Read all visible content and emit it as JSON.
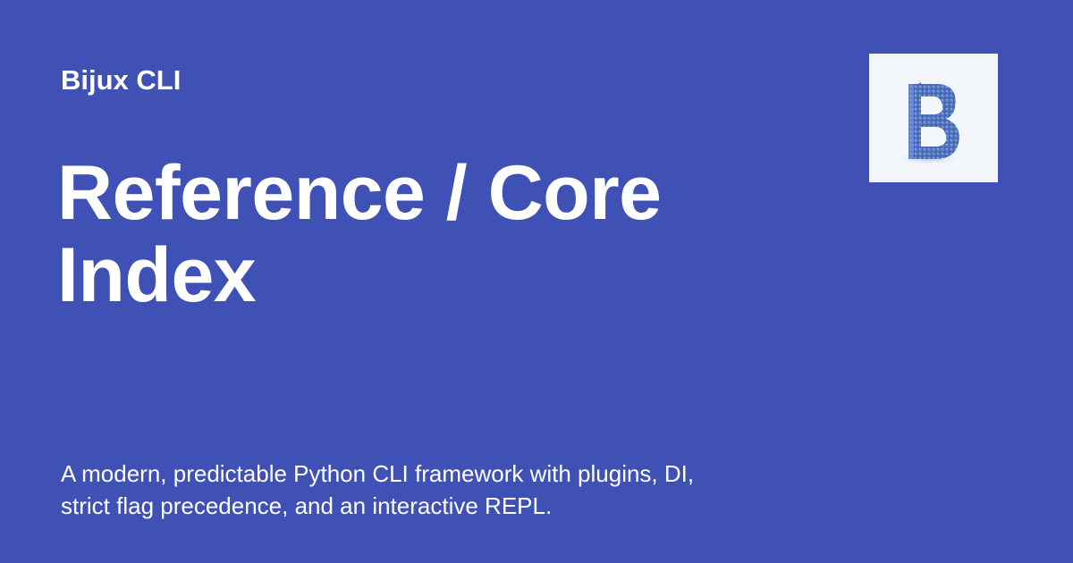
{
  "header": {
    "site_name": "Bijux CLI"
  },
  "page": {
    "title_line1": "Reference / Core",
    "title_line2": "Index",
    "description_line1": "A modern, predictable Python CLI framework with plugins, DI,",
    "description_line2": "strict flag precedence, and an interactive REPL."
  },
  "logo": {
    "icon": "pixel-b-logo-icon",
    "background": "#f3f7fc",
    "accent": "#3a5fae"
  },
  "colors": {
    "background": "#3f51b5",
    "text": "#ffffff"
  }
}
